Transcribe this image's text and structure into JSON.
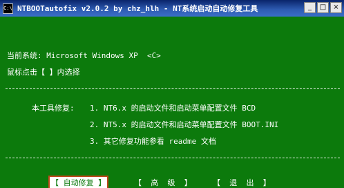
{
  "window": {
    "icon_label": "C:\\",
    "title": "NTBOOTautofix v2.0.2 by chz_hlh - NT系统启动自动修复工具",
    "controls": {
      "minimize": "_",
      "maximize": "□",
      "close": "×"
    }
  },
  "console": {
    "current_system_label": "当前系统: Microsoft Windows XP  <C>",
    "instruction": "鼠标点击【 】内选择",
    "separator": "--------------------------------------------------------------------------------",
    "features_title": "本工具修复:",
    "features": [
      "1. NT6.x 的启动文件和启动菜单配置文件 BCD",
      "2. NT5.x 的启动文件和启动菜单配置文件 BOOT.INI",
      "3. 其它修复功能参看 readme 文档"
    ]
  },
  "buttons": {
    "auto_fix": "【 自动修复 】",
    "advanced": "【  高  级  】",
    "exit": "【  退  出  】"
  }
}
